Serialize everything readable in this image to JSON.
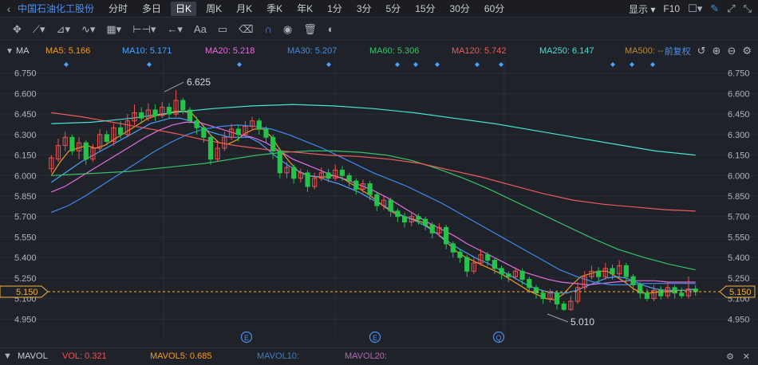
{
  "header": {
    "stock_name": "中国石油化工股份",
    "periods": [
      "分时",
      "多日",
      "日K",
      "周K",
      "月K",
      "季K",
      "年K",
      "1分",
      "3分",
      "5分",
      "15分",
      "30分",
      "60分"
    ],
    "active_period": "日K",
    "display_label": "显示",
    "f10_label": "F10"
  },
  "ma_legend": {
    "title": "MA",
    "items": [
      {
        "label": "MA5: 5.166",
        "color": "#f59a23"
      },
      {
        "label": "MA10: 5.171",
        "color": "#4aa3ff"
      },
      {
        "label": "MA20: 5.218",
        "color": "#e46fe0"
      },
      {
        "label": "MA30: 5.207",
        "color": "#3d8bf0"
      },
      {
        "label": "MA60: 5.306",
        "color": "#36c26b"
      },
      {
        "label": "MA120: 5.742",
        "color": "#ef5a5a"
      },
      {
        "label": "MA250: 6.147",
        "color": "#46e3d6"
      },
      {
        "label": "MA500: --",
        "color": "#b98a3c"
      }
    ],
    "adjust_label": "前复权"
  },
  "axis": {
    "price_ticks": [
      "6.750",
      "6.600",
      "6.450",
      "6.300",
      "6.150",
      "6.000",
      "5.850",
      "5.700",
      "5.550",
      "5.400",
      "5.250",
      "5.100",
      "4.950"
    ],
    "current_price": "5.150",
    "high_label": "6.625",
    "low_label": "5.010"
  },
  "event_markers": [
    "E",
    "E",
    "Q"
  ],
  "volume": {
    "title": "MAVOL",
    "vol": "VOL: 0.321",
    "mavol5": "MAVOL5: 0.685",
    "mavol10": "MAVOL10:",
    "mavol20": "MAVOL20:"
  },
  "colors": {
    "up": "#ef5350",
    "down": "#26c24a",
    "ma5": "#f59a23",
    "ma10": "#4aa3ff",
    "ma20": "#e46fe0",
    "ma30": "#3d8bf0",
    "ma60": "#36c26b",
    "ma120": "#ef5a5a",
    "ma250": "#46e3d6",
    "accent": "#4c8ff0"
  },
  "chart_data": {
    "type": "candlestick",
    "ylim": [
      4.87,
      6.83
    ],
    "candles": [
      [
        6.05,
        6.13,
        6.15,
        6.02
      ],
      [
        6.12,
        6.22,
        6.27,
        6.1
      ],
      [
        6.22,
        6.28,
        6.32,
        6.18
      ],
      [
        6.28,
        6.18,
        6.3,
        6.15
      ],
      [
        6.18,
        6.24,
        6.28,
        6.12
      ],
      [
        6.24,
        6.12,
        6.26,
        6.08
      ],
      [
        6.12,
        6.2,
        6.23,
        6.1
      ],
      [
        6.2,
        6.3,
        6.34,
        6.18
      ],
      [
        6.3,
        6.25,
        6.33,
        6.22
      ],
      [
        6.25,
        6.35,
        6.38,
        6.22
      ],
      [
        6.35,
        6.3,
        6.4,
        6.27
      ],
      [
        6.3,
        6.4,
        6.45,
        6.28
      ],
      [
        6.4,
        6.46,
        6.52,
        6.37
      ],
      [
        6.46,
        6.42,
        6.5,
        6.38
      ],
      [
        6.42,
        6.48,
        6.53,
        6.4
      ],
      [
        6.48,
        6.44,
        6.52,
        6.4
      ],
      [
        6.44,
        6.5,
        6.54,
        6.42
      ],
      [
        6.5,
        6.45,
        6.53,
        6.42
      ],
      [
        6.45,
        6.55,
        6.625,
        6.43
      ],
      [
        6.55,
        6.48,
        6.57,
        6.45
      ],
      [
        6.48,
        6.4,
        6.5,
        6.38
      ],
      [
        6.4,
        6.35,
        6.43,
        6.3
      ],
      [
        6.35,
        6.28,
        6.37,
        6.24
      ],
      [
        6.28,
        6.12,
        6.3,
        6.08
      ],
      [
        6.12,
        6.2,
        6.24,
        6.1
      ],
      [
        6.2,
        6.28,
        6.32,
        6.18
      ],
      [
        6.28,
        6.34,
        6.38,
        6.26
      ],
      [
        6.34,
        6.3,
        6.37,
        6.25
      ],
      [
        6.3,
        6.36,
        6.4,
        6.28
      ],
      [
        6.36,
        6.4,
        6.43,
        6.33
      ],
      [
        6.4,
        6.34,
        6.42,
        6.3
      ],
      [
        6.34,
        6.28,
        6.36,
        6.24
      ],
      [
        6.28,
        6.18,
        6.3,
        6.12
      ],
      [
        6.18,
        6.02,
        6.2,
        5.98
      ],
      [
        6.02,
        6.06,
        6.1,
        5.98
      ],
      [
        6.06,
        5.98,
        6.08,
        5.94
      ],
      [
        5.98,
        6.02,
        6.05,
        5.95
      ],
      [
        6.02,
        5.92,
        6.04,
        5.88
      ],
      [
        5.92,
        5.98,
        6.02,
        5.9
      ],
      [
        5.98,
        6.02,
        6.06,
        5.96
      ],
      [
        6.02,
        5.98,
        6.05,
        5.95
      ],
      [
        5.98,
        6.04,
        6.08,
        5.96
      ],
      [
        6.04,
        6.0,
        6.07,
        5.96
      ],
      [
        6.0,
        5.96,
        6.02,
        5.92
      ],
      [
        5.96,
        5.9,
        5.98,
        5.86
      ],
      [
        5.9,
        5.94,
        5.97,
        5.87
      ],
      [
        5.94,
        5.86,
        5.96,
        5.82
      ],
      [
        5.86,
        5.78,
        5.88,
        5.74
      ],
      [
        5.78,
        5.82,
        5.85,
        5.75
      ],
      [
        5.82,
        5.74,
        5.84,
        5.7
      ],
      [
        5.74,
        5.7,
        5.76,
        5.66
      ],
      [
        5.7,
        5.66,
        5.73,
        5.62
      ],
      [
        5.66,
        5.7,
        5.73,
        5.63
      ],
      [
        5.7,
        5.68,
        5.72,
        5.64
      ],
      [
        5.68,
        5.64,
        5.7,
        5.6
      ],
      [
        5.64,
        5.58,
        5.66,
        5.54
      ],
      [
        5.58,
        5.62,
        5.65,
        5.55
      ],
      [
        5.62,
        5.5,
        5.64,
        5.46
      ],
      [
        5.5,
        5.44,
        5.52,
        5.4
      ],
      [
        5.44,
        5.4,
        5.46,
        5.36
      ],
      [
        5.4,
        5.3,
        5.42,
        5.26
      ],
      [
        5.3,
        5.36,
        5.4,
        5.28
      ],
      [
        5.36,
        5.42,
        5.46,
        5.34
      ],
      [
        5.42,
        5.38,
        5.44,
        5.34
      ],
      [
        5.38,
        5.32,
        5.4,
        5.28
      ],
      [
        5.32,
        5.28,
        5.34,
        5.24
      ],
      [
        5.28,
        5.26,
        5.3,
        5.22
      ],
      [
        5.26,
        5.3,
        5.33,
        5.24
      ],
      [
        5.3,
        5.24,
        5.32,
        5.2
      ],
      [
        5.24,
        5.18,
        5.26,
        5.14
      ],
      [
        5.18,
        5.14,
        5.2,
        5.1
      ],
      [
        5.14,
        5.1,
        5.16,
        5.06
      ],
      [
        5.1,
        5.14,
        5.17,
        5.07
      ],
      [
        5.14,
        5.06,
        5.16,
        5.02
      ],
      [
        5.06,
        5.02,
        5.08,
        5.01
      ],
      [
        5.02,
        5.08,
        5.12,
        5.01
      ],
      [
        5.08,
        5.18,
        5.22,
        5.06
      ],
      [
        5.18,
        5.26,
        5.3,
        5.16
      ],
      [
        5.26,
        5.3,
        5.34,
        5.24
      ],
      [
        5.3,
        5.26,
        5.33,
        5.22
      ],
      [
        5.26,
        5.32,
        5.36,
        5.24
      ],
      [
        5.32,
        5.28,
        5.35,
        5.24
      ],
      [
        5.28,
        5.34,
        5.38,
        5.26
      ],
      [
        5.34,
        5.26,
        5.36,
        5.22
      ],
      [
        5.26,
        5.2,
        5.28,
        5.16
      ],
      [
        5.2,
        5.14,
        5.22,
        5.1
      ],
      [
        5.14,
        5.1,
        5.17,
        5.08
      ],
      [
        5.1,
        5.16,
        5.2,
        5.08
      ],
      [
        5.16,
        5.12,
        5.19,
        5.09
      ],
      [
        5.12,
        5.18,
        5.22,
        5.1
      ],
      [
        5.18,
        5.14,
        5.2,
        5.1
      ],
      [
        5.14,
        5.12,
        5.18,
        5.1
      ],
      [
        5.12,
        5.17,
        5.26,
        5.1
      ],
      [
        5.17,
        5.15,
        5.2,
        5.12
      ]
    ],
    "ma_lines": {
      "ma5": [
        6.0,
        6.1,
        6.18,
        6.2,
        6.22,
        6.2,
        6.22,
        6.26,
        6.3,
        6.34,
        6.38,
        6.42,
        6.44,
        6.45,
        6.47,
        6.47,
        6.45,
        6.38,
        6.3,
        6.24,
        6.23,
        6.26,
        6.31,
        6.34,
        6.34,
        6.28,
        6.18,
        6.1,
        6.03,
        6.0,
        5.99,
        5.99,
        6.0,
        5.98,
        5.94,
        5.9,
        5.86,
        5.81,
        5.76,
        5.72,
        5.7,
        5.68,
        5.66,
        5.61,
        5.56,
        5.5,
        5.44,
        5.4,
        5.37,
        5.34,
        5.31,
        5.28,
        5.24,
        5.2,
        5.16,
        5.13,
        5.1,
        5.09,
        5.13,
        5.2,
        5.26,
        5.28,
        5.3,
        5.3,
        5.26,
        5.22,
        5.17,
        5.14,
        5.14,
        5.15,
        5.15,
        5.16,
        5.16,
        5.17
      ],
      "ma10": [
        5.95,
        6.0,
        6.05,
        6.1,
        6.14,
        6.18,
        6.22,
        6.26,
        6.3,
        6.34,
        6.38,
        6.4,
        6.42,
        6.42,
        6.4,
        6.36,
        6.32,
        6.3,
        6.28,
        6.28,
        6.28,
        6.24,
        6.18,
        6.12,
        6.07,
        6.03,
        6.0,
        5.99,
        5.96,
        5.94,
        5.91,
        5.88,
        5.84,
        5.8,
        5.76,
        5.72,
        5.69,
        5.66,
        5.62,
        5.57,
        5.52,
        5.47,
        5.43,
        5.39,
        5.36,
        5.32,
        5.28,
        5.24,
        5.2,
        5.17,
        5.15,
        5.14,
        5.14,
        5.16,
        5.19,
        5.22,
        5.25,
        5.26,
        5.25,
        5.22,
        5.19,
        5.17,
        5.16,
        5.16,
        5.16,
        5.17
      ],
      "ma20": [
        5.88,
        5.92,
        5.98,
        6.04,
        6.1,
        6.16,
        6.22,
        6.28,
        6.33,
        6.37,
        6.39,
        6.39,
        6.36,
        6.33,
        6.3,
        6.28,
        6.24,
        6.18,
        6.12,
        6.08,
        6.04,
        6.0,
        5.97,
        5.93,
        5.89,
        5.84,
        5.78,
        5.72,
        5.66,
        5.61,
        5.56,
        5.5,
        5.45,
        5.4,
        5.35,
        5.3,
        5.27,
        5.24,
        5.22,
        5.21,
        5.2,
        5.21,
        5.22,
        5.23,
        5.23,
        5.23,
        5.22,
        5.22,
        5.22
      ],
      "ma30": [
        5.73,
        5.78,
        5.85,
        5.93,
        6.01,
        6.09,
        6.17,
        6.24,
        6.3,
        6.34,
        6.36,
        6.37,
        6.36,
        6.34,
        6.3,
        6.25,
        6.2,
        6.14,
        6.08,
        6.02,
        5.97,
        5.92,
        5.86,
        5.8,
        5.73,
        5.66,
        5.59,
        5.52,
        5.45,
        5.38,
        5.31,
        5.26,
        5.22,
        5.2,
        5.2,
        5.21,
        5.21,
        5.21,
        5.21
      ],
      "ma60": [
        6.0,
        6.01,
        6.02,
        6.03,
        6.05,
        6.07,
        6.09,
        6.12,
        6.15,
        6.17,
        6.18,
        6.18,
        6.17,
        6.15,
        6.11,
        6.05,
        5.98,
        5.9,
        5.81,
        5.72,
        5.63,
        5.54,
        5.46,
        5.4,
        5.35,
        5.31
      ],
      "ma120": [
        6.46,
        6.43,
        6.39,
        6.35,
        6.31,
        6.26,
        6.22,
        6.19,
        6.17,
        6.15,
        6.14,
        6.12,
        6.09,
        6.04,
        5.99,
        5.93,
        5.87,
        5.82,
        5.79,
        5.77,
        5.75,
        5.74
      ],
      "ma250": [
        6.38,
        6.39,
        6.42,
        6.46,
        6.49,
        6.51,
        6.52,
        6.51,
        6.49,
        6.46,
        6.42,
        6.38,
        6.33,
        6.28,
        6.23,
        6.18,
        6.15
      ]
    }
  }
}
